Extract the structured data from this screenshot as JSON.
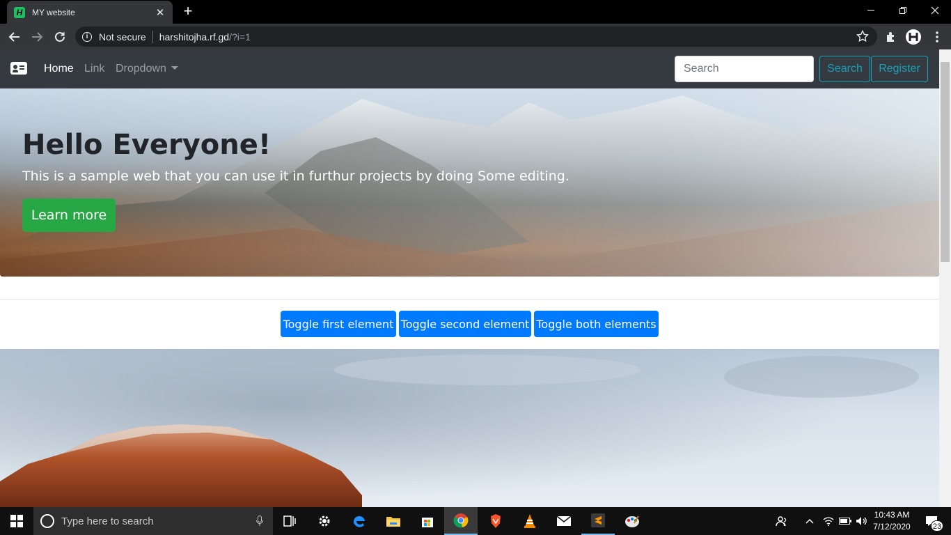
{
  "browser": {
    "tab_title": "MY website",
    "tab_close": "✕",
    "new_tab": "+",
    "security_label": "Not secure",
    "url_host": "harshitojha.rf.gd",
    "url_path": "/?i=1"
  },
  "navbar": {
    "home": "Home",
    "link": "Link",
    "dropdown": "Dropdown",
    "search_placeholder": "Search",
    "search_button": "Search",
    "register_button": "Register"
  },
  "jumbotron": {
    "title": "Hello Everyone!",
    "lead": "This is a sample web that you can use it in furthur projects by doing Some editing.",
    "button": "Learn more"
  },
  "toggles": {
    "first": "Toggle first element",
    "second": "Toggle second element",
    "both": "Toggle both elements"
  },
  "taskbar": {
    "search_placeholder": "Type here to search",
    "time": "10:43 AM",
    "date": "7/12/2020",
    "notifications": "23"
  },
  "colors": {
    "navbar_bg": "#343a40",
    "outline_info": "#17a2b8",
    "success": "#28a745",
    "primary": "#007bff"
  }
}
